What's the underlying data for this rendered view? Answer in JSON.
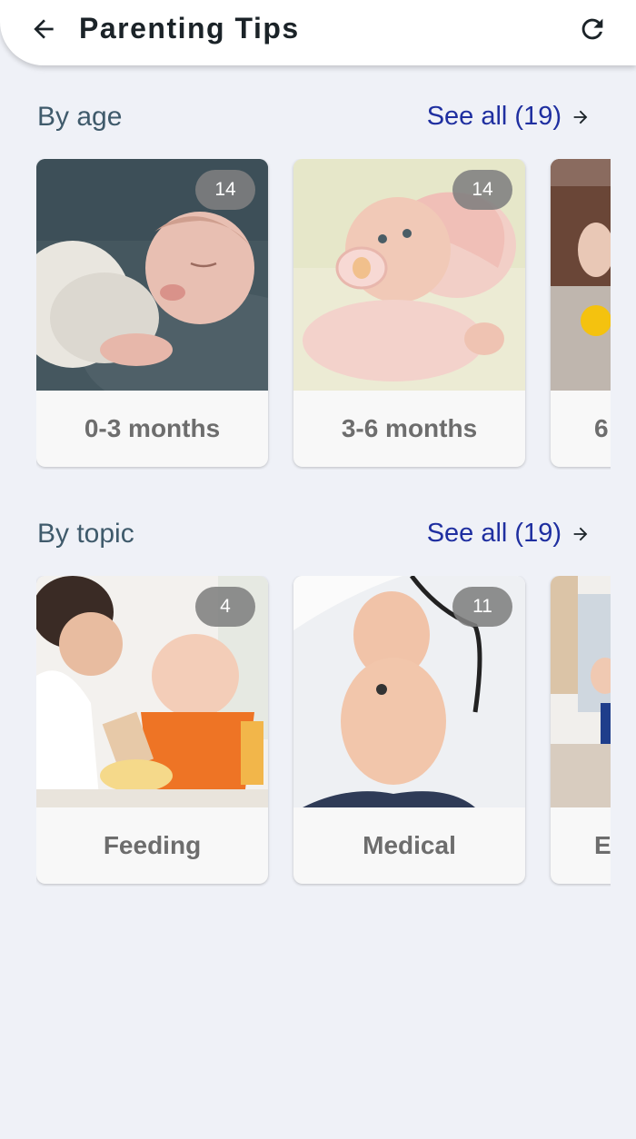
{
  "app": {
    "title": "Parenting Tips"
  },
  "icons": {
    "back": "arrow-back-icon",
    "refresh": "refresh-icon",
    "see_all_arrow": "arrow-forward-icon"
  },
  "colors": {
    "link": "#1f2fa0",
    "section_title": "#3f5a6b",
    "background": "#eff1f7"
  },
  "sections": {
    "by_age": {
      "title": "By age",
      "see_all": "See all (19)",
      "cards": [
        {
          "label": "0-3 months",
          "count": "14",
          "image": "sleeping-newborn-photo"
        },
        {
          "label": "3-6 months",
          "count": "14",
          "image": "baby-with-pacifier-photo"
        },
        {
          "label": "6",
          "image": "baby-playing-with-ball-photo"
        }
      ]
    },
    "by_topic": {
      "title": "By topic",
      "see_all": "See all (19)",
      "cards": [
        {
          "label": "Feeding",
          "count": "4",
          "image": "mother-feeding-baby-photo"
        },
        {
          "label": "Medical",
          "count": "11",
          "image": "doctor-with-baby-photo"
        },
        {
          "label": "En",
          "image": "baby-playing-photo"
        }
      ]
    }
  }
}
